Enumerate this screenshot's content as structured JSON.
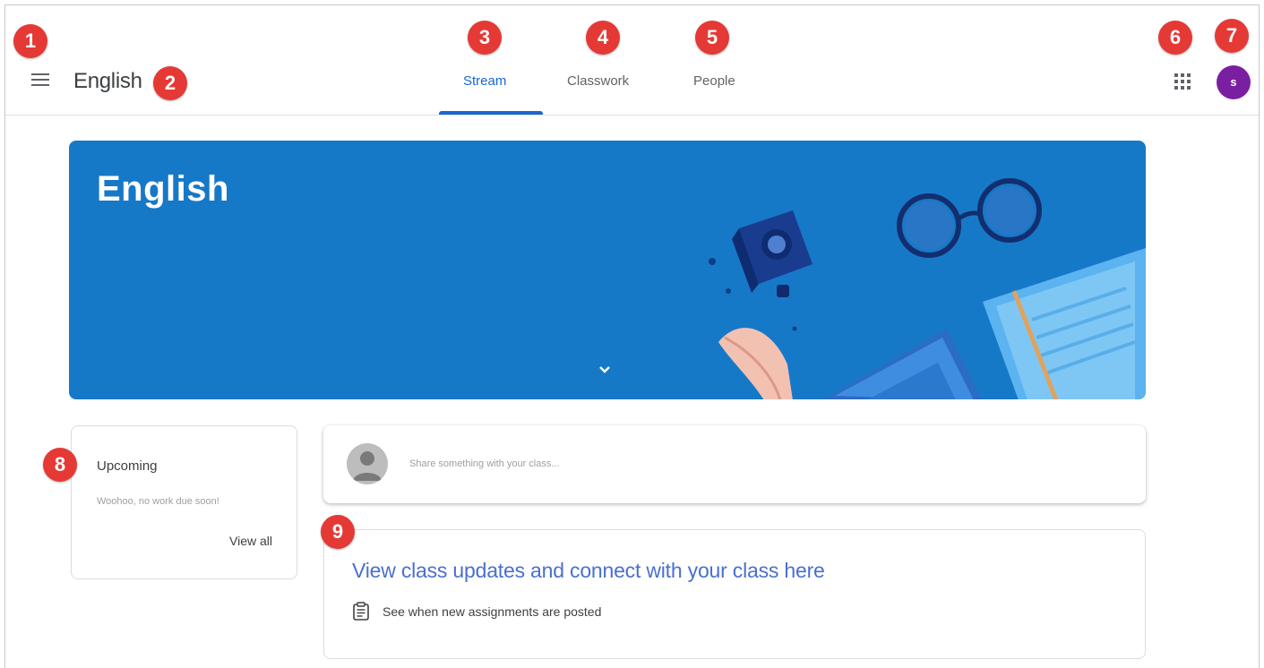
{
  "header": {
    "class_name": "English",
    "tabs": [
      {
        "label": "Stream",
        "active": true
      },
      {
        "label": "Classwork",
        "active": false
      },
      {
        "label": "People",
        "active": false
      }
    ],
    "avatar_letter": "s",
    "avatar_color": "#7b1fa2"
  },
  "banner": {
    "title": "English",
    "color": "#1679c8"
  },
  "upcoming": {
    "title": "Upcoming",
    "message": "Woohoo, no work due soon!",
    "view_all": "View all"
  },
  "share": {
    "placeholder": "Share something with your class..."
  },
  "updates": {
    "heading": "View class updates and connect with your class here",
    "detail": "See when new assignments are posted"
  },
  "markers": [
    "1",
    "2",
    "3",
    "4",
    "5",
    "6",
    "7",
    "8",
    "9"
  ],
  "colors": {
    "accent": "#1967d2",
    "marker": "#e53935"
  }
}
